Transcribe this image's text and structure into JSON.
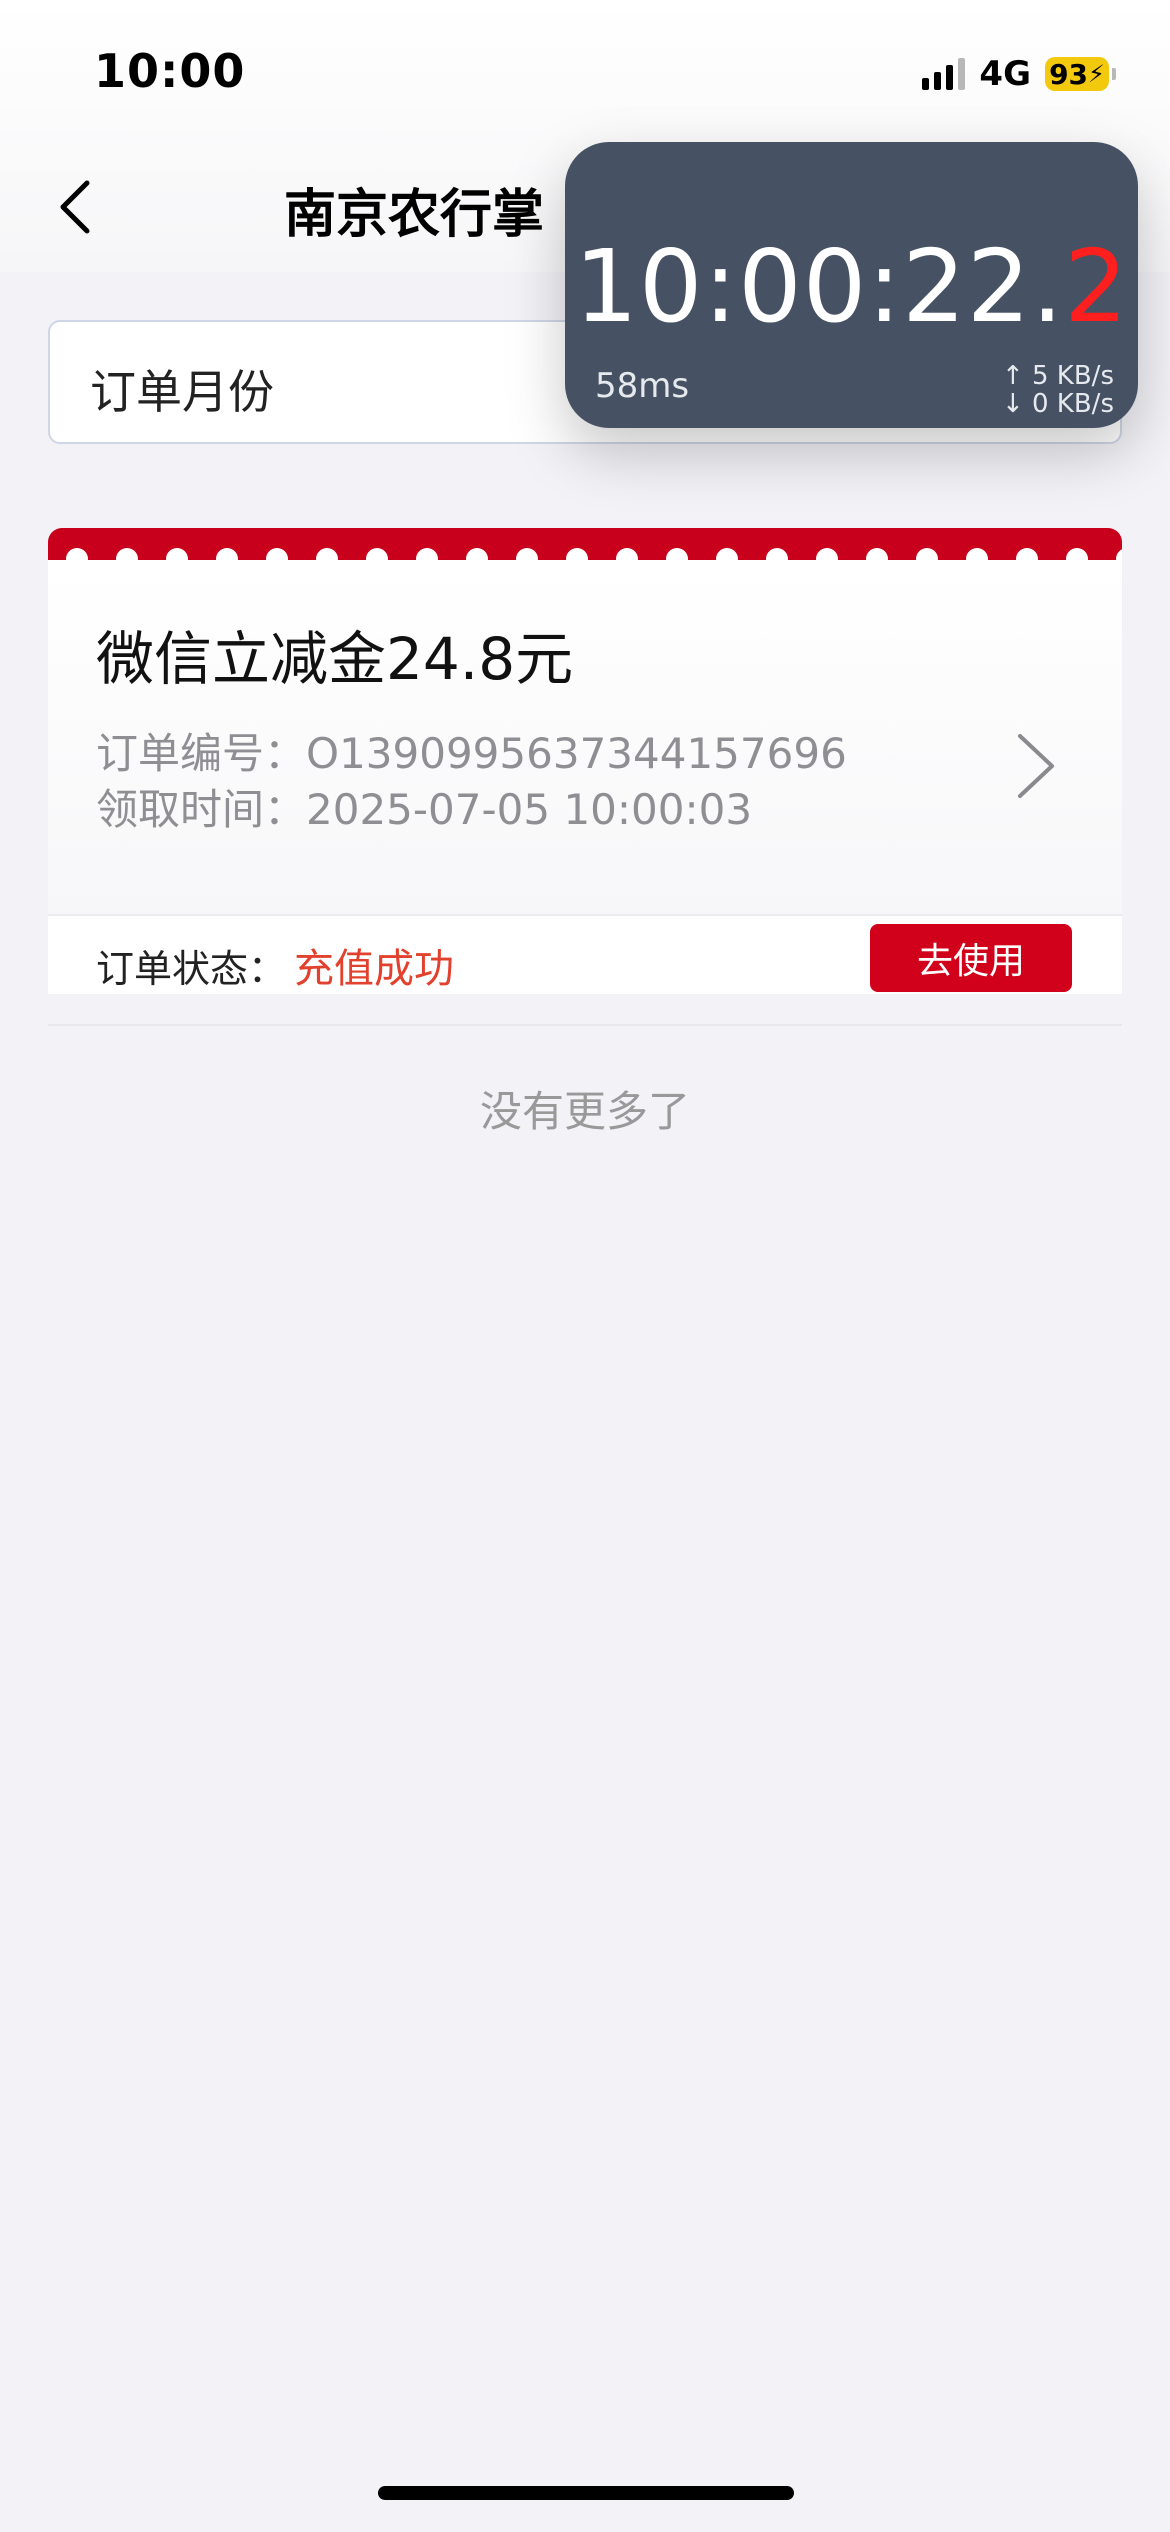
{
  "status_bar": {
    "time": "10:00",
    "network": "4G",
    "battery": "93"
  },
  "nav": {
    "title": "南京农行掌"
  },
  "filter": {
    "month_label": "订单月份"
  },
  "timer": {
    "time_main": "10:00:22.",
    "time_fraction": "2",
    "latency": "58ms",
    "upload": "↑ 5 KB/s",
    "download": "↓ 0 KB/s"
  },
  "order": {
    "title": "微信立减金24.8元",
    "number_label": "订单编号：",
    "number_value": "O1390995637344157696",
    "time_label": "领取时间：",
    "time_value": "2025-07-05 10:00:03",
    "status_label": "订单状态：",
    "status_value": "充值成功",
    "action_label": "去使用"
  },
  "footer": {
    "no_more": "没有更多了"
  },
  "colors": {
    "accent": "#d1001b",
    "status_success": "#e2412e",
    "timer_bg": "#465263",
    "battery": "#f3c90e"
  }
}
